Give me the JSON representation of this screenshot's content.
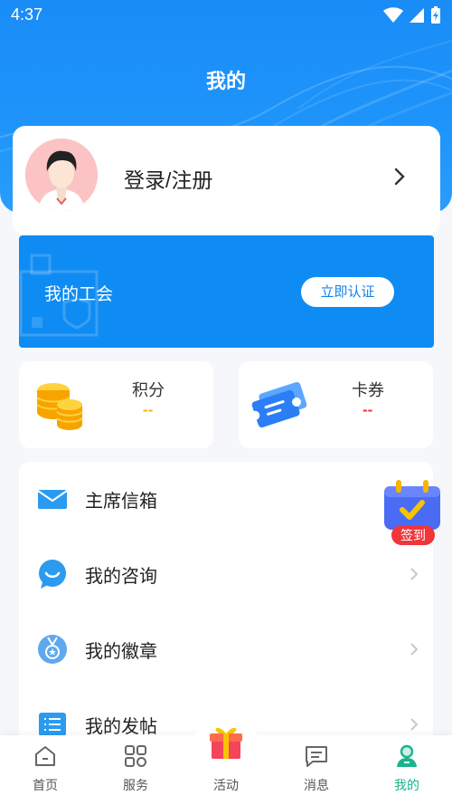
{
  "status_bar": {
    "time": "4:37"
  },
  "header": {
    "title": "我的"
  },
  "login": {
    "label": "登录/注册"
  },
  "union": {
    "title": "我的工会",
    "button_label": "立即认证"
  },
  "points": {
    "label": "积分",
    "value": "--",
    "value_color": "#f5b21b"
  },
  "coupons": {
    "label": "卡券",
    "value": "--",
    "value_color": "#f0353b"
  },
  "menu": {
    "items": [
      {
        "label": "主席信箱",
        "icon": "mail-icon"
      },
      {
        "label": "我的咨询",
        "icon": "chat-bubble-icon"
      },
      {
        "label": "我的徽章",
        "icon": "badge-medal-icon"
      },
      {
        "label": "我的发帖",
        "icon": "post-list-icon"
      }
    ]
  },
  "signin": {
    "label": "签到"
  },
  "tabs": [
    {
      "label": "首页",
      "icon": "home-icon"
    },
    {
      "label": "服务",
      "icon": "services-grid-icon"
    },
    {
      "label": "活动",
      "icon": "gift-box-icon"
    },
    {
      "label": "消息",
      "icon": "message-icon"
    },
    {
      "label": "我的",
      "icon": "profile-icon",
      "active": true
    }
  ],
  "colors": {
    "brand": "#1e95fb",
    "active_tab": "#1bb38f"
  }
}
